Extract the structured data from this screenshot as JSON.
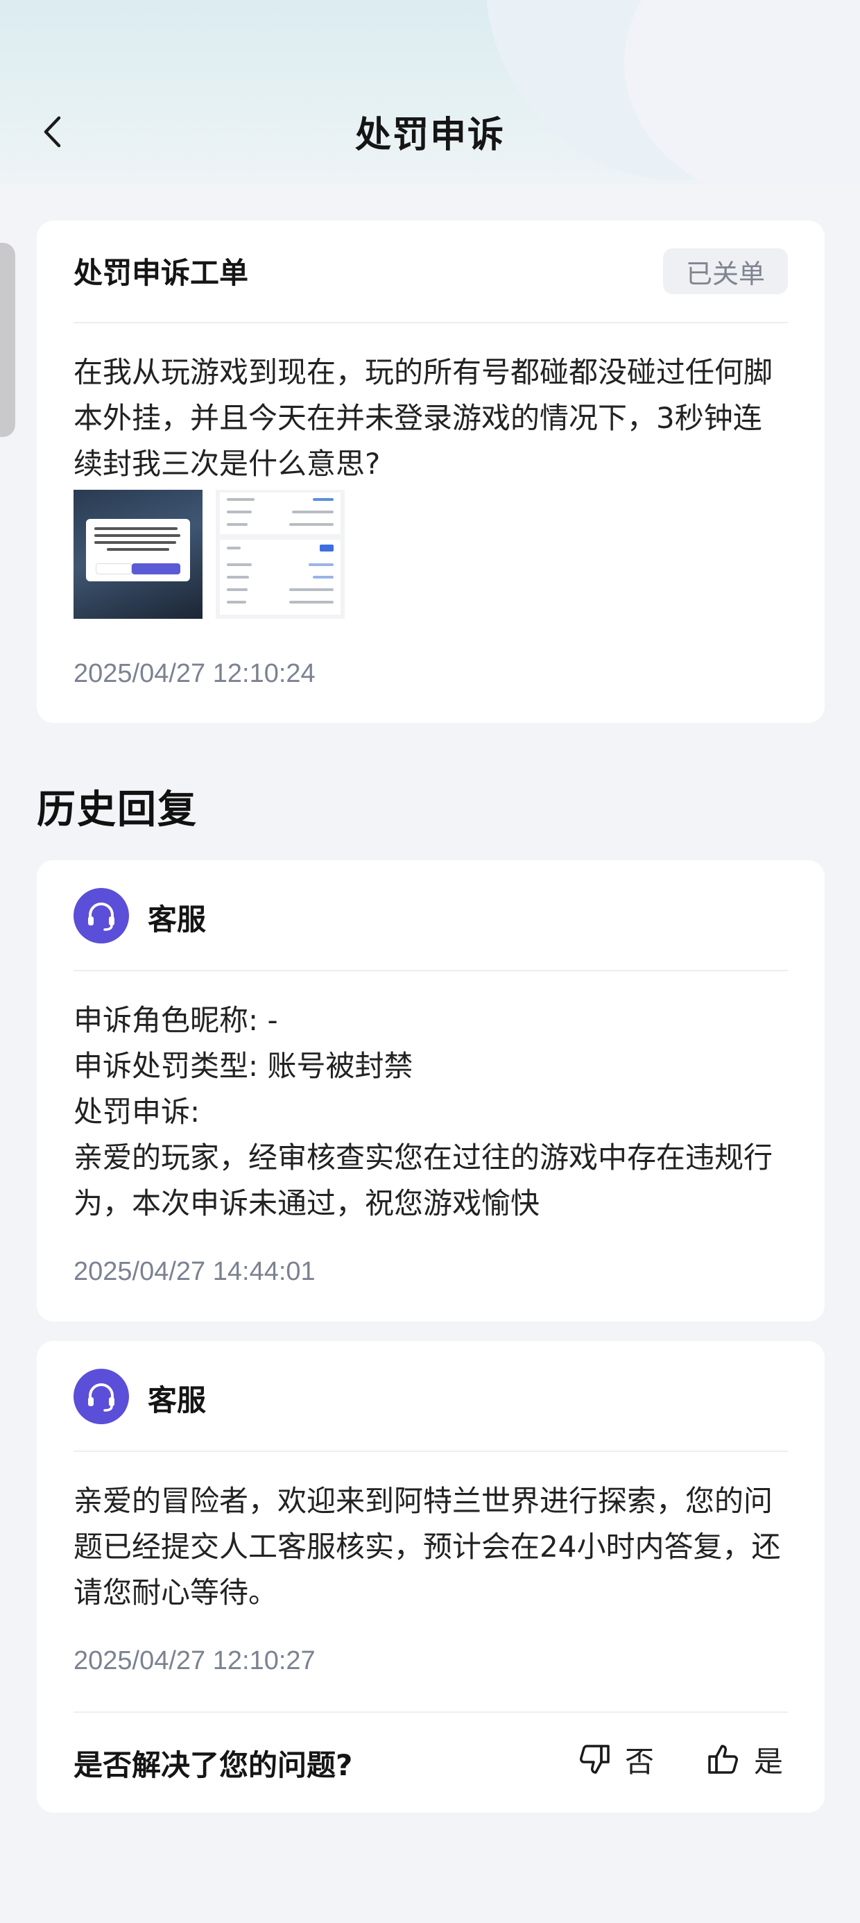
{
  "header": {
    "title": "处罚申诉"
  },
  "ticket": {
    "title": "处罚申诉工单",
    "status": "已关单",
    "content": "在我从玩游戏到现在，玩的所有号都碰都没碰过任何脚本外挂，并且今天在并未登录游戏的情况下，3秒钟连续封我三次是什么意思?",
    "timestamp": "2025/04/27 12:10:24"
  },
  "history": {
    "title": "历史回复",
    "replies": [
      {
        "agent": "客服",
        "content": "申诉角色昵称: -\n申诉处罚类型: 账号被封禁\n处罚申诉:\n亲爱的玩家，经审核查实您在过往的游戏中存在违规行为，本次申诉未通过，祝您游戏愉快",
        "timestamp": "2025/04/27 14:44:01"
      },
      {
        "agent": "客服",
        "content": "亲爱的冒险者，欢迎来到阿特兰世界进行探索，您的问题已经提交人工客服核实，预计会在24小时内答复，还请您耐心等待。",
        "timestamp": "2025/04/27 12:10:27"
      }
    ]
  },
  "feedback": {
    "question": "是否解决了您的问题?",
    "no_label": "否",
    "yes_label": "是"
  },
  "icons": {
    "back": "chevron-left-icon",
    "agent": "headset-icon",
    "dislike": "thumbs-down-icon",
    "like": "thumbs-up-icon"
  },
  "colors": {
    "accent": "#5b4ed8",
    "page_bg": "#f3f4f7",
    "timestamp": "#7b8291"
  }
}
